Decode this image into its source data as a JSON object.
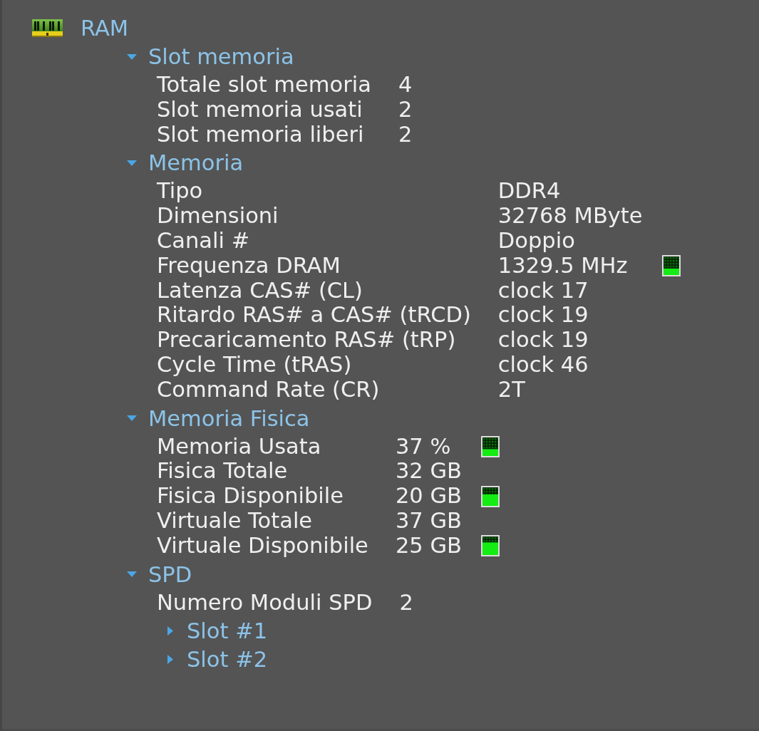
{
  "tree": {
    "label": "RAM",
    "children": [
      {
        "kind": "group",
        "label": "Slot memoria",
        "expanded": true,
        "children": [
          {
            "kind": "property",
            "label": "Totale slot memoria",
            "value": "4"
          },
          {
            "kind": "property",
            "label": "Slot memoria usati",
            "value": "2"
          },
          {
            "kind": "property",
            "label": "Slot memoria liberi",
            "value": "2"
          }
        ]
      },
      {
        "kind": "group",
        "label": "Memoria",
        "expanded": true,
        "children": [
          {
            "kind": "property",
            "label": "Tipo",
            "value": "DDR4"
          },
          {
            "kind": "property",
            "label": "Dimensioni",
            "value": "32768 MByte"
          },
          {
            "kind": "property",
            "label": "Canali #",
            "value": "Doppio"
          },
          {
            "kind": "property",
            "label": "Frequenza DRAM",
            "value": "1329.5 MHz",
            "level": 0.35
          },
          {
            "kind": "property",
            "label": "Latenza CAS# (CL)",
            "value": "clock 17"
          },
          {
            "kind": "property",
            "label": "Ritardo RAS# a CAS# (tRCD)",
            "value": "clock 19"
          },
          {
            "kind": "property",
            "label": "Precaricamento RAS# (tRP)",
            "value": "clock 19"
          },
          {
            "kind": "property",
            "label": "Cycle Time (tRAS)",
            "value": "clock 46"
          },
          {
            "kind": "property",
            "label": "Command Rate (CR)",
            "value": "2T"
          }
        ]
      },
      {
        "kind": "group",
        "label": "Memoria Fisica",
        "expanded": true,
        "children": [
          {
            "kind": "property",
            "label": "Memoria Usata",
            "value": "37 %",
            "level": 0.37
          },
          {
            "kind": "property",
            "label": "Fisica Totale",
            "value": "32 GB"
          },
          {
            "kind": "property",
            "label": "Fisica Disponibile",
            "value": "20 GB",
            "level": 0.62
          },
          {
            "kind": "property",
            "label": "Virtuale Totale",
            "value": "37 GB"
          },
          {
            "kind": "property",
            "label": "Virtuale Disponibile",
            "value": "25 GB",
            "level": 0.68
          }
        ]
      },
      {
        "kind": "group",
        "label": "SPD",
        "expanded": true,
        "children": [
          {
            "kind": "property",
            "label": "Numero Moduli SPD",
            "value": "2"
          },
          {
            "kind": "group",
            "label": "Slot #1",
            "expanded": false
          },
          {
            "kind": "group",
            "label": "Slot #2",
            "expanded": false
          }
        ]
      }
    ]
  }
}
